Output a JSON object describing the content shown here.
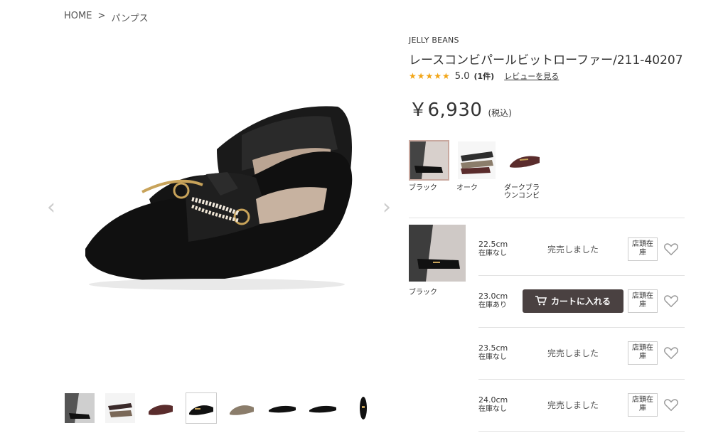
{
  "breadcrumb": {
    "home": "HOME",
    "separator": ">",
    "category": "パンプス"
  },
  "product": {
    "brand": "JELLY BEANS",
    "title": "レースコンビパールビットローファー/211-40207",
    "stars": "★★★★★",
    "rating": "5.0",
    "review_count": "(1件)",
    "review_link": "レビューを見る",
    "price": "￥6,930",
    "tax_label": "(税込)"
  },
  "gallery": {
    "prev_icon": "‹",
    "next_icon": "›",
    "thumb_count": 8
  },
  "colors": [
    {
      "label": "ブラック",
      "swatch": "#1e1e1e"
    },
    {
      "label": "オーク",
      "swatch": "#8b7d6b"
    },
    {
      "label": "ダークブラウンコンビ",
      "swatch": "#5a2c2c"
    }
  ],
  "selected_variant": {
    "label": "ブラック"
  },
  "sizes": [
    {
      "size": "22.5cm",
      "stock": "在庫なし",
      "status": "完売しました",
      "store": "店頭在庫"
    },
    {
      "size": "23.0cm",
      "stock": "在庫あり",
      "cart": "カートに入れる",
      "store": "店頭在庫"
    },
    {
      "size": "23.5cm",
      "stock": "在庫なし",
      "status": "完売しました",
      "store": "店頭在庫"
    },
    {
      "size": "24.0cm",
      "stock": "在庫なし",
      "status": "完売しました",
      "store": "店頭在庫"
    }
  ],
  "colors_theme": {
    "star": "#f2a516",
    "cart_button": "#4a4141",
    "selected_border": "#c9a9a0"
  }
}
